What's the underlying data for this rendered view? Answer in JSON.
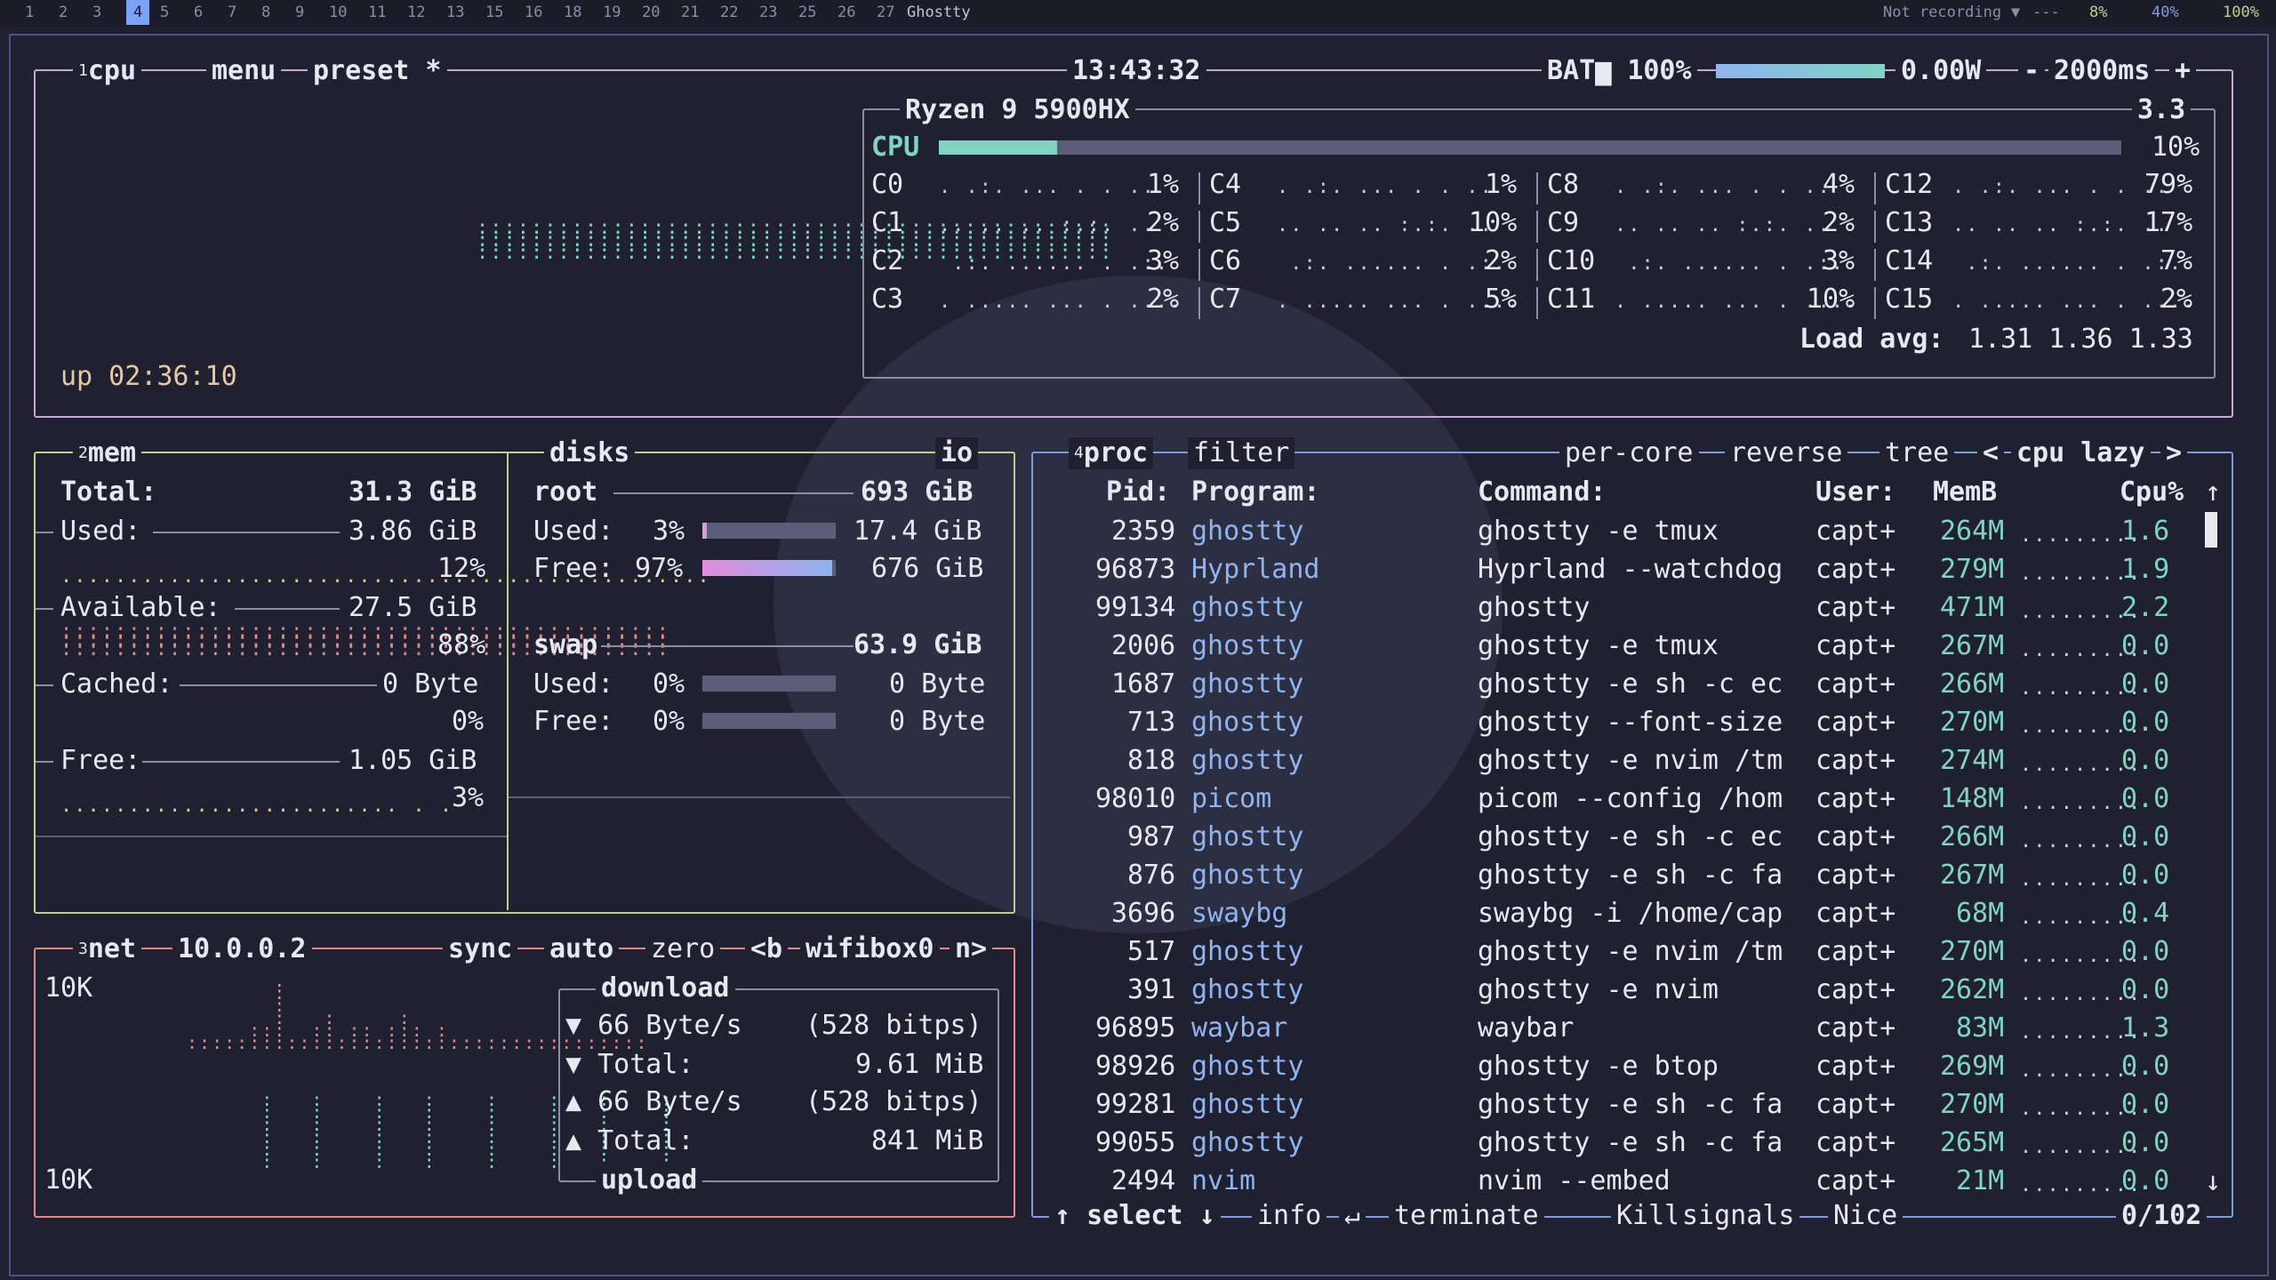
{
  "topbar": {
    "workspaces": [
      "1",
      "2",
      "3",
      "4",
      "5",
      "6",
      "7",
      "8",
      "9",
      "10",
      "11",
      "12",
      "13",
      "15",
      "16",
      "18",
      "19",
      "20",
      "21",
      "22",
      "23",
      "25",
      "26",
      "27"
    ],
    "active_workspace": "4",
    "window_title": "Ghostty",
    "recording": "Not recording",
    "net_status": "---",
    "stat1": "8%",
    "stat2": "40%",
    "stat3": "100%"
  },
  "cpu": {
    "tab_num": "1",
    "tab_label": "cpu",
    "menu_label": "menu",
    "preset_label": "preset *",
    "clock": "13:43:32",
    "battery_label": "BAT",
    "battery_pct": "100%",
    "battery_level": 1.0,
    "power": "0.00W",
    "minus": "-",
    "interval": "2000ms",
    "plus": "+",
    "model": "Ryzen 9 5900HX",
    "freq": "3.3",
    "total_label": "CPU",
    "total_pct": "10%",
    "total_value": 0.1,
    "uptime": "up 02:36:10",
    "cores": [
      {
        "name": "C0",
        "pct": "1%"
      },
      {
        "name": "C1",
        "pct": "2%"
      },
      {
        "name": "C2",
        "pct": "3%"
      },
      {
        "name": "C3",
        "pct": "2%"
      },
      {
        "name": "C4",
        "pct": "1%"
      },
      {
        "name": "C5",
        "pct": "10%"
      },
      {
        "name": "C6",
        "pct": "2%"
      },
      {
        "name": "C7",
        "pct": "5%"
      },
      {
        "name": "C8",
        "pct": "4%"
      },
      {
        "name": "C9",
        "pct": "2%"
      },
      {
        "name": "C10",
        "pct": "3%"
      },
      {
        "name": "C11",
        "pct": "10%"
      },
      {
        "name": "C12",
        "pct": "79%"
      },
      {
        "name": "C13",
        "pct": "17%"
      },
      {
        "name": "C14",
        "pct": "7%"
      },
      {
        "name": "C15",
        "pct": "2%"
      }
    ],
    "load_label": "Load avg:",
    "load_values": "1.31 1.36 1.33"
  },
  "mem": {
    "tab_num": "2",
    "tab_label": "mem",
    "total_label": "Total:",
    "total_value": "31.3 GiB",
    "used_label": "Used:",
    "used_value": "3.86 GiB",
    "used_pct": "12%",
    "avail_label": "Available:",
    "avail_value": "27.5 GiB",
    "avail_pct": "88%",
    "cached_label": "Cached:",
    "cached_value": "0 Byte",
    "cached_pct": "0%",
    "free_label": "Free:",
    "free_value": "1.05 GiB",
    "free_pct": "3%"
  },
  "disks": {
    "label": "disks",
    "io_label": "io",
    "root_label": "root",
    "root_size": "693 GiB",
    "root_used_label": "Used:",
    "root_used_pct": "3%",
    "root_used_value": "17.4 GiB",
    "root_used_level": 0.03,
    "root_free_label": "Free:",
    "root_free_pct": "97%",
    "root_free_value": "676 GiB",
    "root_free_level": 0.97,
    "swap_label": "swap",
    "swap_size": "63.9 GiB",
    "swap_used_label": "Used:",
    "swap_used_pct": "0%",
    "swap_used_value": "0 Byte",
    "swap_free_label": "Free:",
    "swap_free_pct": "0%",
    "swap_free_value": "0 Byte"
  },
  "net": {
    "tab_num": "3",
    "tab_label": "net",
    "ip": "10.0.0.2",
    "sync": "sync",
    "auto": "auto",
    "zero": "zero",
    "prev": "<b",
    "iface": "wifibox0",
    "next": "n>",
    "scale_top": "10K",
    "scale_bottom": "10K",
    "download_label": "download",
    "dl_rate": "66 Byte/s",
    "dl_bits": "(528 bitps)",
    "dl_total_label": "Total:",
    "dl_total": "9.61 MiB",
    "ul_rate": "66 Byte/s",
    "ul_bits": "(528 bitps)",
    "ul_total_label": "Total:",
    "ul_total": "841 MiB",
    "upload_label": "upload"
  },
  "proc": {
    "tab_num": "4",
    "tab_label": "proc",
    "filter": "filter",
    "per_core": "per-core",
    "reverse": "reverse",
    "tree": "tree",
    "sort_prev": "<",
    "sort": "cpu lazy",
    "sort_next": ">",
    "headers": {
      "pid": "Pid:",
      "program": "Program:",
      "command": "Command:",
      "user": "User:",
      "mem": "MemB",
      "cpu": "Cpu%"
    },
    "rows": [
      {
        "pid": "2359",
        "program": "ghostty",
        "command": "ghostty -e tmux",
        "user": "capt+",
        "mem": "264M",
        "cpu": "1.6"
      },
      {
        "pid": "96873",
        "program": "Hyprland",
        "command": "Hyprland --watchdog",
        "user": "capt+",
        "mem": "279M",
        "cpu": "1.9"
      },
      {
        "pid": "99134",
        "program": "ghostty",
        "command": "ghostty",
        "user": "capt+",
        "mem": "471M",
        "cpu": "2.2"
      },
      {
        "pid": "2006",
        "program": "ghostty",
        "command": "ghostty -e tmux",
        "user": "capt+",
        "mem": "267M",
        "cpu": "0.0"
      },
      {
        "pid": "1687",
        "program": "ghostty",
        "command": "ghostty -e sh -c ec",
        "user": "capt+",
        "mem": "266M",
        "cpu": "0.0"
      },
      {
        "pid": "713",
        "program": "ghostty",
        "command": "ghostty --font-size",
        "user": "capt+",
        "mem": "270M",
        "cpu": "0.0"
      },
      {
        "pid": "818",
        "program": "ghostty",
        "command": "ghostty -e nvim /tm",
        "user": "capt+",
        "mem": "274M",
        "cpu": "0.0"
      },
      {
        "pid": "98010",
        "program": "picom",
        "command": "picom --config /hom",
        "user": "capt+",
        "mem": "148M",
        "cpu": "0.0"
      },
      {
        "pid": "987",
        "program": "ghostty",
        "command": "ghostty -e sh -c ec",
        "user": "capt+",
        "mem": "266M",
        "cpu": "0.0"
      },
      {
        "pid": "876",
        "program": "ghostty",
        "command": "ghostty -e sh -c fa",
        "user": "capt+",
        "mem": "267M",
        "cpu": "0.0"
      },
      {
        "pid": "3696",
        "program": "swaybg",
        "command": "swaybg -i /home/cap",
        "user": "capt+",
        "mem": "68M",
        "cpu": "0.4"
      },
      {
        "pid": "517",
        "program": "ghostty",
        "command": "ghostty -e nvim /tm",
        "user": "capt+",
        "mem": "270M",
        "cpu": "0.0"
      },
      {
        "pid": "391",
        "program": "ghostty",
        "command": "ghostty -e nvim",
        "user": "capt+",
        "mem": "262M",
        "cpu": "0.0"
      },
      {
        "pid": "96895",
        "program": "waybar",
        "command": "waybar",
        "user": "capt+",
        "mem": "83M",
        "cpu": "1.3"
      },
      {
        "pid": "98926",
        "program": "ghostty",
        "command": "ghostty -e btop",
        "user": "capt+",
        "mem": "269M",
        "cpu": "0.0"
      },
      {
        "pid": "99281",
        "program": "ghostty",
        "command": "ghostty -e sh -c fa",
        "user": "capt+",
        "mem": "270M",
        "cpu": "0.0"
      },
      {
        "pid": "99055",
        "program": "ghostty",
        "command": "ghostty -e sh -c fa",
        "user": "capt+",
        "mem": "265M",
        "cpu": "0.0"
      },
      {
        "pid": "2494",
        "program": "nvim",
        "command": "nvim --embed",
        "user": "capt+",
        "mem": "21M",
        "cpu": "0.0"
      }
    ],
    "footer": {
      "select": "select",
      "info": "info",
      "terminate": "terminate",
      "kill": "Kill",
      "signals": "signals",
      "nice": "Nice",
      "count": "0/102"
    }
  },
  "colors": {
    "cpu_border": "#c9a6d8",
    "mem_border": "#b7d38a",
    "net_border": "#e08b8b",
    "proc_border": "#7f9bd8",
    "accent": "#7fd4c4"
  }
}
